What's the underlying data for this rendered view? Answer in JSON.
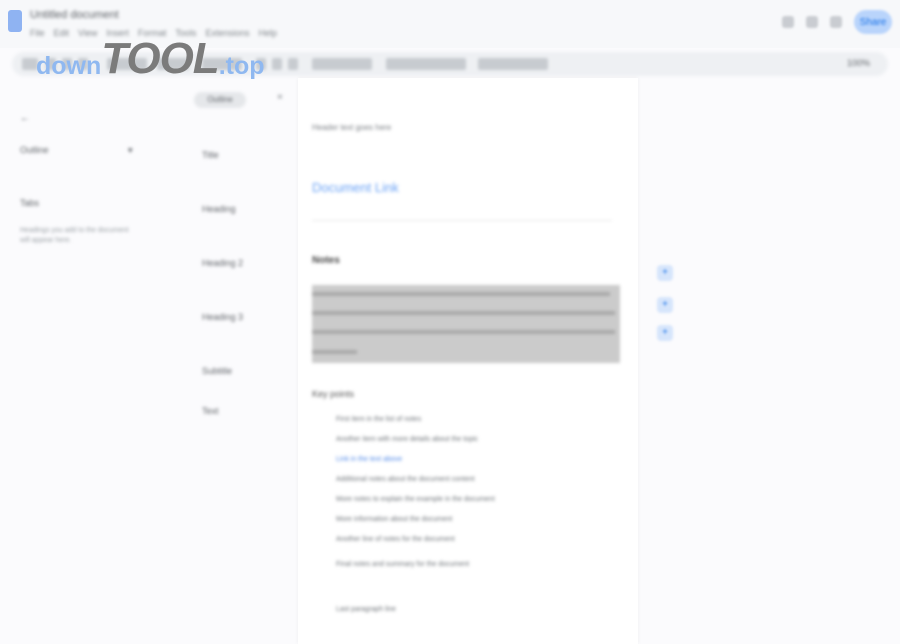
{
  "app": {
    "title": "Untitled document",
    "menus": [
      "File",
      "Edit",
      "View",
      "Insert",
      "Format",
      "Tools",
      "Extensions",
      "Help"
    ]
  },
  "header_right": {
    "share_label": "Share"
  },
  "toolbar": {
    "zoom": "100%"
  },
  "watermark": {
    "down": "down",
    "tool": "TOOL",
    "top": ".top"
  },
  "sidebar": {
    "title": "←",
    "tab_label": "Outline",
    "tab_caret": "▾",
    "heading": "Tabs",
    "description": "Headings you add to the document will appear here."
  },
  "outline": {
    "pill": "Outline",
    "close": "×",
    "items": [
      "Title",
      "Heading",
      "Heading 2",
      "Heading 3",
      "Subtitle",
      "Text"
    ]
  },
  "document": {
    "header_text": "Header text goes here",
    "link": "Document Link",
    "h2": "Notes",
    "h3": "Key points",
    "list_items": [
      "First item in the list of notes",
      "Another item with more details about the topic",
      "Link in the text above",
      "Additional notes about the document content",
      "More notes to explain the example in the document",
      "More information about the document",
      "Another line of notes for the document",
      "Final notes and summary for the document",
      "Last paragraph line"
    ]
  },
  "scroll_controls": [
    "+",
    "+",
    "+"
  ]
}
